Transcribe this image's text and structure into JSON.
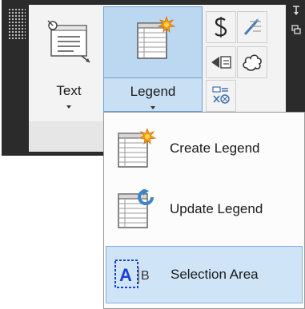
{
  "ribbon": {
    "text_button": {
      "label": "Text",
      "icon": "text-icon"
    },
    "legend_button": {
      "label": "Legend",
      "icon": "legend-icon"
    },
    "tools": [
      {
        "icon": "spelling-icon"
      },
      {
        "icon": "wand-icon"
      },
      {
        "icon": "leader-arrow-icon"
      },
      {
        "icon": "cloud-icon"
      },
      {
        "icon": "label-tool-icon"
      }
    ]
  },
  "menu": {
    "items": [
      {
        "label": "Create Legend",
        "icon": "create-legend-icon",
        "selected": false
      },
      {
        "label": "Update Legend",
        "icon": "update-legend-icon",
        "selected": false
      },
      {
        "label": "Selection Area",
        "icon": "selection-area-icon",
        "selected": true
      }
    ]
  },
  "colors": {
    "panel_bg": "#2b2b2b",
    "highlight": "#bcd8f0",
    "highlight_border": "#6fa1cf",
    "menu_hover": "#cfe5f7"
  }
}
